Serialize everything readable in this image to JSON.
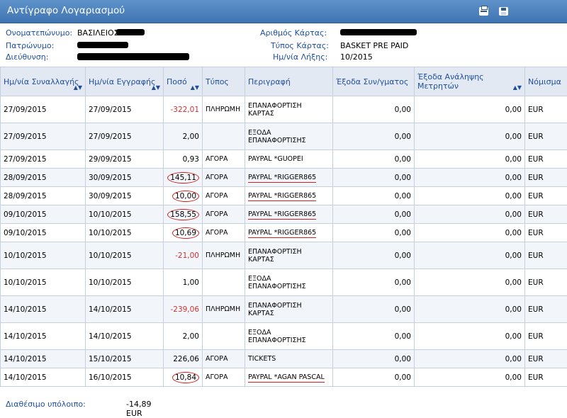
{
  "window": {
    "title": "Αντίγραφο Λογαριασμού"
  },
  "toolbar": {
    "print_icon": "print-icon",
    "save_icon": "save-icon"
  },
  "info": {
    "name_label": "Ονοματεπώνυμο:",
    "name_value": "ΒΑΣΙΛΕΙΟΣ",
    "father_label": "Πατρώνυμο:",
    "address_label": "Διεύθυνση:",
    "card_no_label": "Αριθμός Κάρτας:",
    "card_type_label": "Τύπος Κάρτας:",
    "card_type_value": "BASKET PRE PAID",
    "expiry_label": "Ημ/νία Λήξης:",
    "expiry_value": "10/2015"
  },
  "table": {
    "headers": [
      "Ημ/νία Συναλλαγής",
      "Ημ/νία Εγγραφής",
      "Ποσό",
      "Τύπος",
      "Περιγραφή",
      "Έξοδα Συν/γματος",
      "Έξοδα Ανάληψης Μετρητών",
      "Νόμισμα"
    ],
    "rows": [
      [
        "27/09/2015",
        "27/09/2015",
        "-322,01",
        "ΠΛΗΡΩΜΗ",
        "ΕΠΑΝΑΦΟΡΤΙΣΗ ΚΑΡΤΑΣ",
        "0,00",
        "0,00",
        "EUR"
      ],
      [
        "27/09/2015",
        "27/09/2015",
        "2,00",
        "",
        "ΕΞΟΔΑ ΕΠΑΝΑΦΟΡΤΙΣΗΣ",
        "0,00",
        "0,00",
        "EUR"
      ],
      [
        "27/09/2015",
        "29/09/2015",
        "0,93",
        "ΑΓΟΡΑ",
        "PAYPAL *GUOPEI",
        "0,00",
        "0,00",
        "EUR"
      ],
      [
        "28/09/2015",
        "30/09/2015",
        "145,11",
        "ΑΓΟΡΑ",
        "PAYPAL *RIGGER865",
        "0,00",
        "0,00",
        "EUR"
      ],
      [
        "28/09/2015",
        "30/09/2015",
        "10,00",
        "ΑΓΟΡΑ",
        "PAYPAL *RIGGER865",
        "0,00",
        "0,00",
        "EUR"
      ],
      [
        "09/10/2015",
        "10/10/2015",
        "158,55",
        "ΑΓΟΡΑ",
        "PAYPAL *RIGGER865",
        "0,00",
        "0,00",
        "EUR"
      ],
      [
        "09/10/2015",
        "10/10/2015",
        "10,69",
        "ΑΓΟΡΑ",
        "PAYPAL *RIGGER865",
        "0,00",
        "0,00",
        "EUR"
      ],
      [
        "10/10/2015",
        "10/10/2015",
        "-21,00",
        "ΠΛΗΡΩΜΗ",
        "ΕΠΑΝΑΦΟΡΤΙΣΗ ΚΑΡΤΑΣ",
        "0,00",
        "0,00",
        "EUR"
      ],
      [
        "10/10/2015",
        "10/10/2015",
        "1,00",
        "",
        "ΕΞΟΔΑ ΕΠΑΝΑΦΟΡΤΙΣΗΣ",
        "0,00",
        "0,00",
        "EUR"
      ],
      [
        "14/10/2015",
        "14/10/2015",
        "-239,06",
        "ΠΛΗΡΩΜΗ",
        "ΕΠΑΝΑΦΟΡΤΙΣΗ ΚΑΡΤΑΣ",
        "0,00",
        "0,00",
        "EUR"
      ],
      [
        "14/10/2015",
        "14/10/2015",
        "2,00",
        "",
        "ΕΞΟΔΑ ΕΠΑΝΑΦΟΡΤΙΣΗΣ",
        "0,00",
        "0,00",
        "EUR"
      ],
      [
        "14/10/2015",
        "15/10/2015",
        "226,06",
        "ΑΓΟΡΑ",
        "TICKETS",
        "0,00",
        "0,00",
        "EUR"
      ],
      [
        "14/10/2015",
        "16/10/2015",
        "10,84",
        "ΑΓΟΡΑ",
        "PAYPAL *AGAN PASCAL",
        "0,00",
        "0,00",
        "EUR"
      ]
    ]
  },
  "footer": {
    "balance_label": "Διαθέσιμο υπόλοιπο:",
    "balance_value": "-14,89 EUR"
  },
  "colors": {
    "accent": "#3f74b3",
    "label": "#1f4f9c",
    "negative": "#cc3333",
    "annotation": "#d42020"
  }
}
